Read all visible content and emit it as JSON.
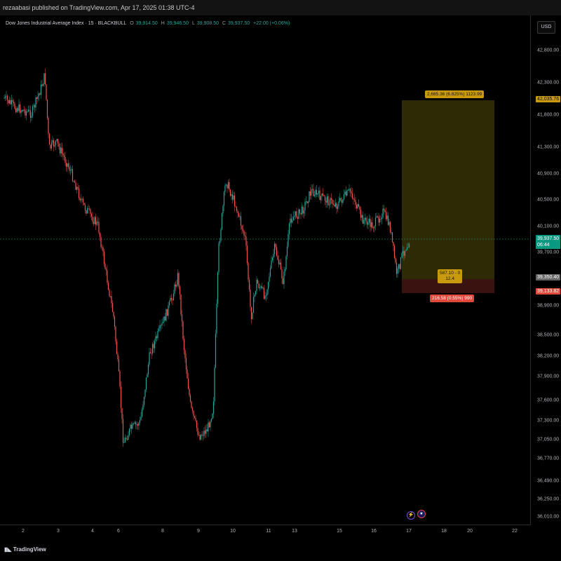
{
  "header": {
    "publisher_text": "rezaabasi published on TradingView.com, Apr 17, 2025 01:38 UTC-4"
  },
  "legend": {
    "symbol": "Dow Jones Industrial Average Index · 15 · BLACKBULL",
    "o_label": "O",
    "o_value": "39,914.50",
    "h_label": "H",
    "h_value": "39,946.50",
    "l_label": "L",
    "l_value": "39,908.50",
    "c_label": "C",
    "c_value": "39,937.50",
    "change": "+22.00 (+0.06%)"
  },
  "currency_button": "USD",
  "y_axis": {
    "ticks": [
      "42,800.00",
      "42,300.00",
      "41,800.00",
      "41,300.00",
      "40,900.00",
      "40,500.00",
      "40,100.00",
      "39,700.00",
      "38,900.00",
      "38,500.00",
      "38,200.00",
      "37,900.00",
      "37,600.00",
      "37,300.00",
      "37,050.00",
      "36,770.00",
      "36,490.00",
      "36,250.00",
      "36,010.00"
    ]
  },
  "x_axis": {
    "ticks": [
      "2",
      "3",
      "4",
      "6",
      "8",
      "9",
      "10",
      "11",
      "13",
      "15",
      "16",
      "17",
      "18",
      "20",
      "22"
    ]
  },
  "price_tags": {
    "target": "42,035.76",
    "current_price": "39,937.50",
    "countdown": "06:44",
    "entry": "39,350.40",
    "stop": "39,133.82"
  },
  "position_tool": {
    "target_label": "2,685.36 (6.825%) 1123.99",
    "entry_line1": "587.10 - 0",
    "entry_line2": "12.4",
    "stop_label": "216.58 (0.55%) 990"
  },
  "colors": {
    "up": "#26a69a",
    "down": "#ef5350",
    "target_zone": "#2d2a05",
    "stop_zone": "#3a1210",
    "target_tag": "#c99a0e",
    "stop_tag": "#e0483b",
    "current_tag": "#089981"
  },
  "footer": {
    "logo_text": "TradingView"
  },
  "events": {
    "event1_icon": "lightning-icon",
    "event2_icon": "us-flag-icon"
  },
  "chart_data": {
    "type": "line",
    "title": "Dow Jones Industrial Average Index · 15 · BLACKBULL",
    "x": [
      "2",
      "3",
      "4",
      "6",
      "8",
      "9",
      "10",
      "11",
      "13",
      "15",
      "16",
      "17"
    ],
    "series": [
      {
        "values": [
          41950,
          41900,
          41000,
          40200,
          37500,
          37100,
          40800,
          39300,
          40600,
          40650,
          40000,
          39937.5
        ]
      }
    ],
    "ylim": [
      36010,
      42800
    ]
  }
}
